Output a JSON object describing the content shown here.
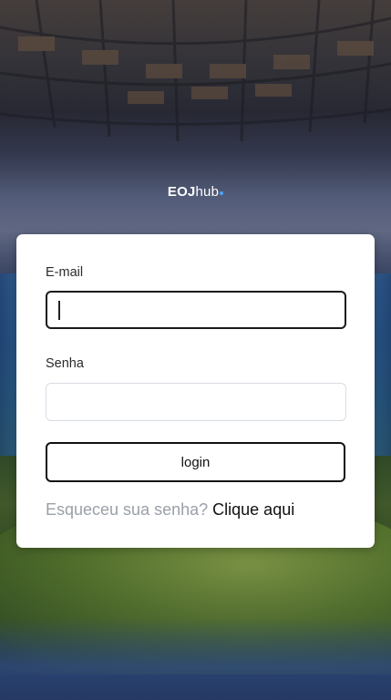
{
  "brand": {
    "logo_bold": "EOJ",
    "logo_light": "hub",
    "accent_color": "#4fa3ff"
  },
  "form": {
    "email_label": "E-mail",
    "email_value": "",
    "email_placeholder": "",
    "password_label": "Senha",
    "password_value": "",
    "password_placeholder": "",
    "login_label": "login",
    "forgot_text": "Esqueceu sua senha?",
    "forgot_link": "Clique aqui"
  }
}
